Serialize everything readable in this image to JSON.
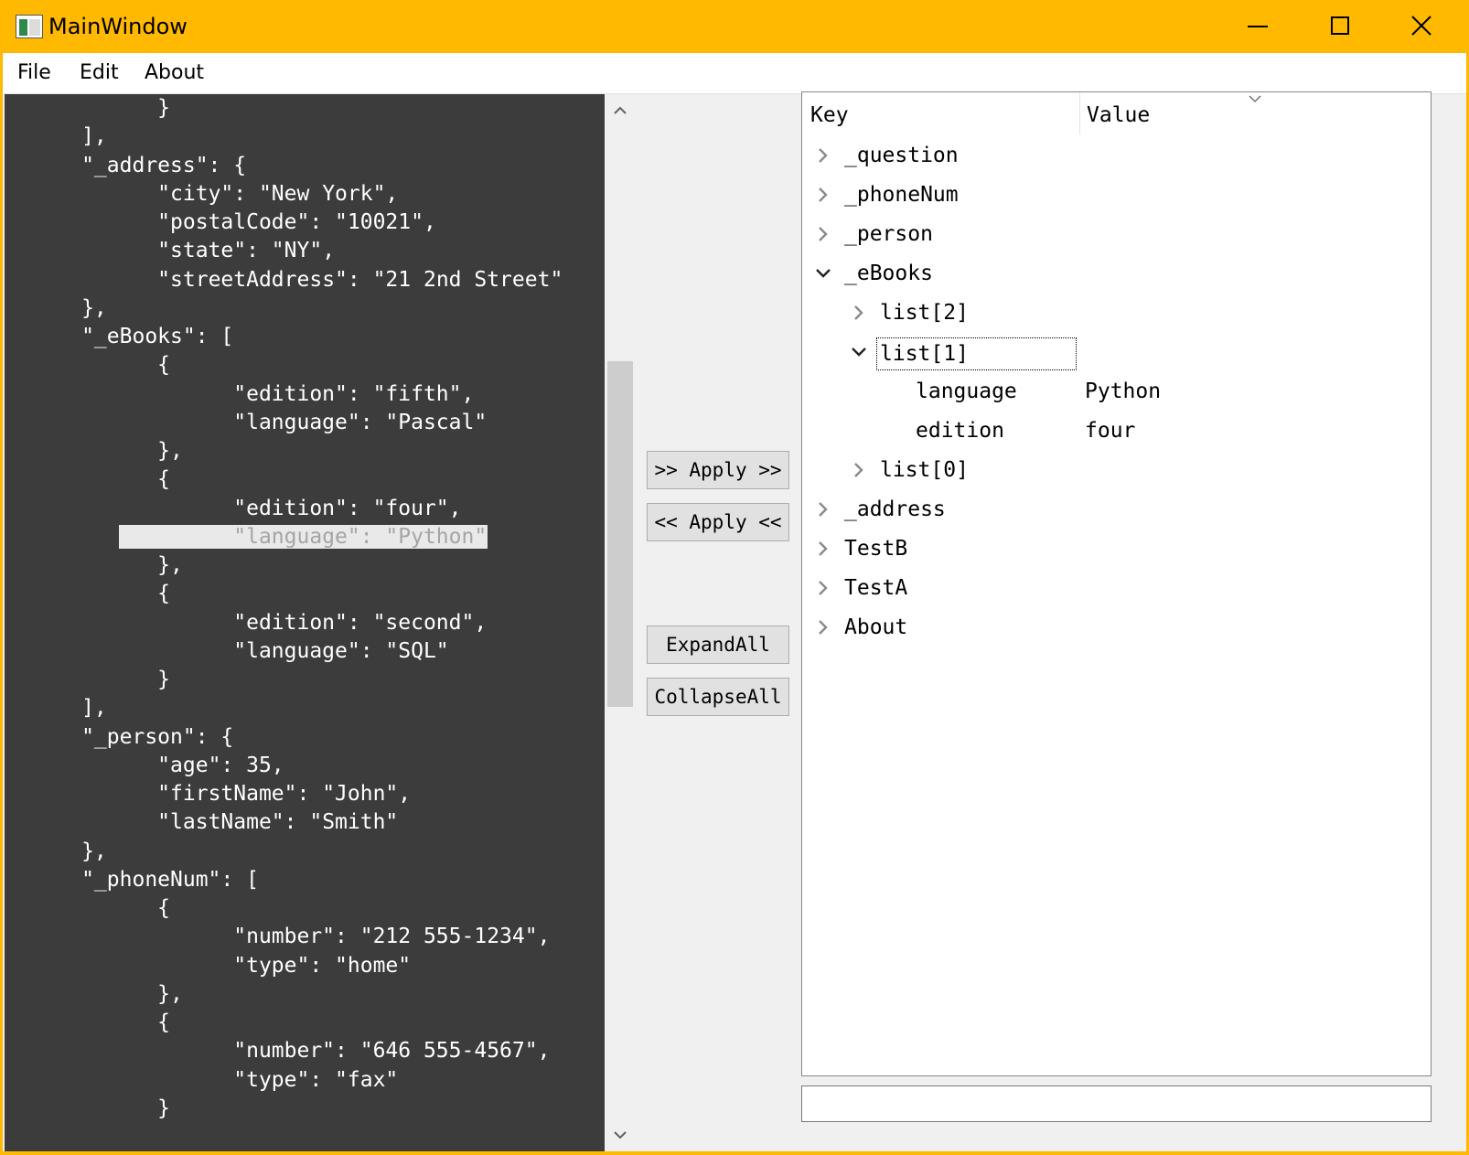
{
  "window": {
    "title": "MainWindow",
    "accent_color": "#ffb900",
    "controls": [
      "minimize-icon",
      "maximize-icon",
      "close-icon"
    ]
  },
  "menu": {
    "file": "File",
    "edit": "Edit",
    "about": "About"
  },
  "editor": {
    "background": "#3c3c3c",
    "lines": [
      "      }",
      "   ],",
      "   \"_address\": {",
      "      \"city\": \"New York\",",
      "      \"postalCode\": \"10021\",",
      "      \"state\": \"NY\",",
      "      \"streetAddress\": \"21 2nd Street\"",
      "   },",
      "   \"_eBooks\": [",
      "      {",
      "         \"edition\": \"fifth\",",
      "         \"language\": \"Pascal\"",
      "      },",
      "      {",
      "         \"edition\": \"four\",",
      "         \"language\": \"Python\"",
      "      },",
      "      {",
      "         \"edition\": \"second\",",
      "         \"language\": \"SQL\"",
      "      }",
      "   ],",
      "   \"_person\": {",
      "      \"age\": 35,",
      "      \"firstName\": \"John\",",
      "      \"lastName\": \"Smith\"",
      "   },",
      "   \"_phoneNum\": [",
      "      {",
      "         \"number\": \"212 555-1234\",",
      "         \"type\": \"home\"",
      "      },",
      "      {",
      "         \"number\": \"646 555-4567\",",
      "         \"type\": \"fax\"",
      "      }"
    ],
    "selected_line": 15,
    "scroll_icons": [
      "chevron-up-icon",
      "chevron-down-icon"
    ]
  },
  "buttons": {
    "apply_right": ">> Apply >>",
    "apply_left": "<< Apply <<",
    "expand_all": "ExpandAll",
    "collapse_all": "CollapseAll"
  },
  "tree": {
    "header_key": "Key",
    "header_value": "Value",
    "rows": [
      {
        "key": "_question",
        "value": "",
        "level": 0,
        "expander": "collapsed"
      },
      {
        "key": "_phoneNum",
        "value": "",
        "level": 0,
        "expander": "collapsed"
      },
      {
        "key": "_person",
        "value": "",
        "level": 0,
        "expander": "collapsed"
      },
      {
        "key": "_eBooks",
        "value": "",
        "level": 0,
        "expander": "expanded"
      },
      {
        "key": "list[2]",
        "value": "",
        "level": 1,
        "expander": "collapsed"
      },
      {
        "key": "list[1]",
        "value": "",
        "level": 1,
        "expander": "expanded",
        "focused": true
      },
      {
        "key": "language",
        "value": "Python",
        "level": 2,
        "expander": "none"
      },
      {
        "key": "edition",
        "value": "four",
        "level": 2,
        "expander": "none"
      },
      {
        "key": "list[0]",
        "value": "",
        "level": 1,
        "expander": "collapsed"
      },
      {
        "key": "_address",
        "value": "",
        "level": 0,
        "expander": "collapsed"
      },
      {
        "key": "TestB",
        "value": "",
        "level": 0,
        "expander": "collapsed"
      },
      {
        "key": "TestA",
        "value": "",
        "level": 0,
        "expander": "collapsed"
      },
      {
        "key": "About",
        "value": "",
        "level": 0,
        "expander": "collapsed"
      }
    ]
  },
  "status_field": {
    "value": ""
  }
}
